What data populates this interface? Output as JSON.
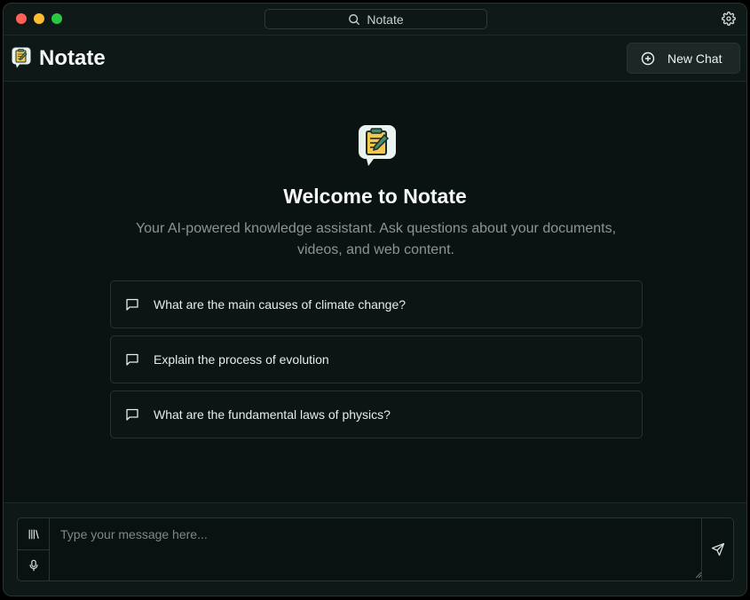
{
  "titlebar": {
    "search_label": "Notate",
    "icons": {
      "search": "search-icon",
      "settings": "gear-icon"
    }
  },
  "header": {
    "app_title": "Notate",
    "new_chat_label": "New Chat",
    "icons": {
      "logo": "notate-logo-icon",
      "new_chat": "plus-circle-icon"
    }
  },
  "main": {
    "welcome_title": "Welcome to Notate",
    "subtitle": "Your AI-powered knowledge assistant. Ask questions about your documents, videos, and web content.",
    "suggestions": [
      {
        "label": "What are the main causes of climate change?",
        "icon": "message-square-icon"
      },
      {
        "label": "Explain the process of evolution",
        "icon": "message-square-icon"
      },
      {
        "label": "What are the fundamental laws of physics?",
        "icon": "message-square-icon"
      }
    ]
  },
  "composer": {
    "placeholder": "Type your message here...",
    "value": "",
    "icons": {
      "library": "library-icon",
      "mic": "microphone-icon",
      "send": "send-icon"
    }
  },
  "colors": {
    "background": "#0b1312",
    "accent_logo": "#f2c94c",
    "text_primary": "#f5f8f7",
    "text_muted": "#8a9592"
  }
}
